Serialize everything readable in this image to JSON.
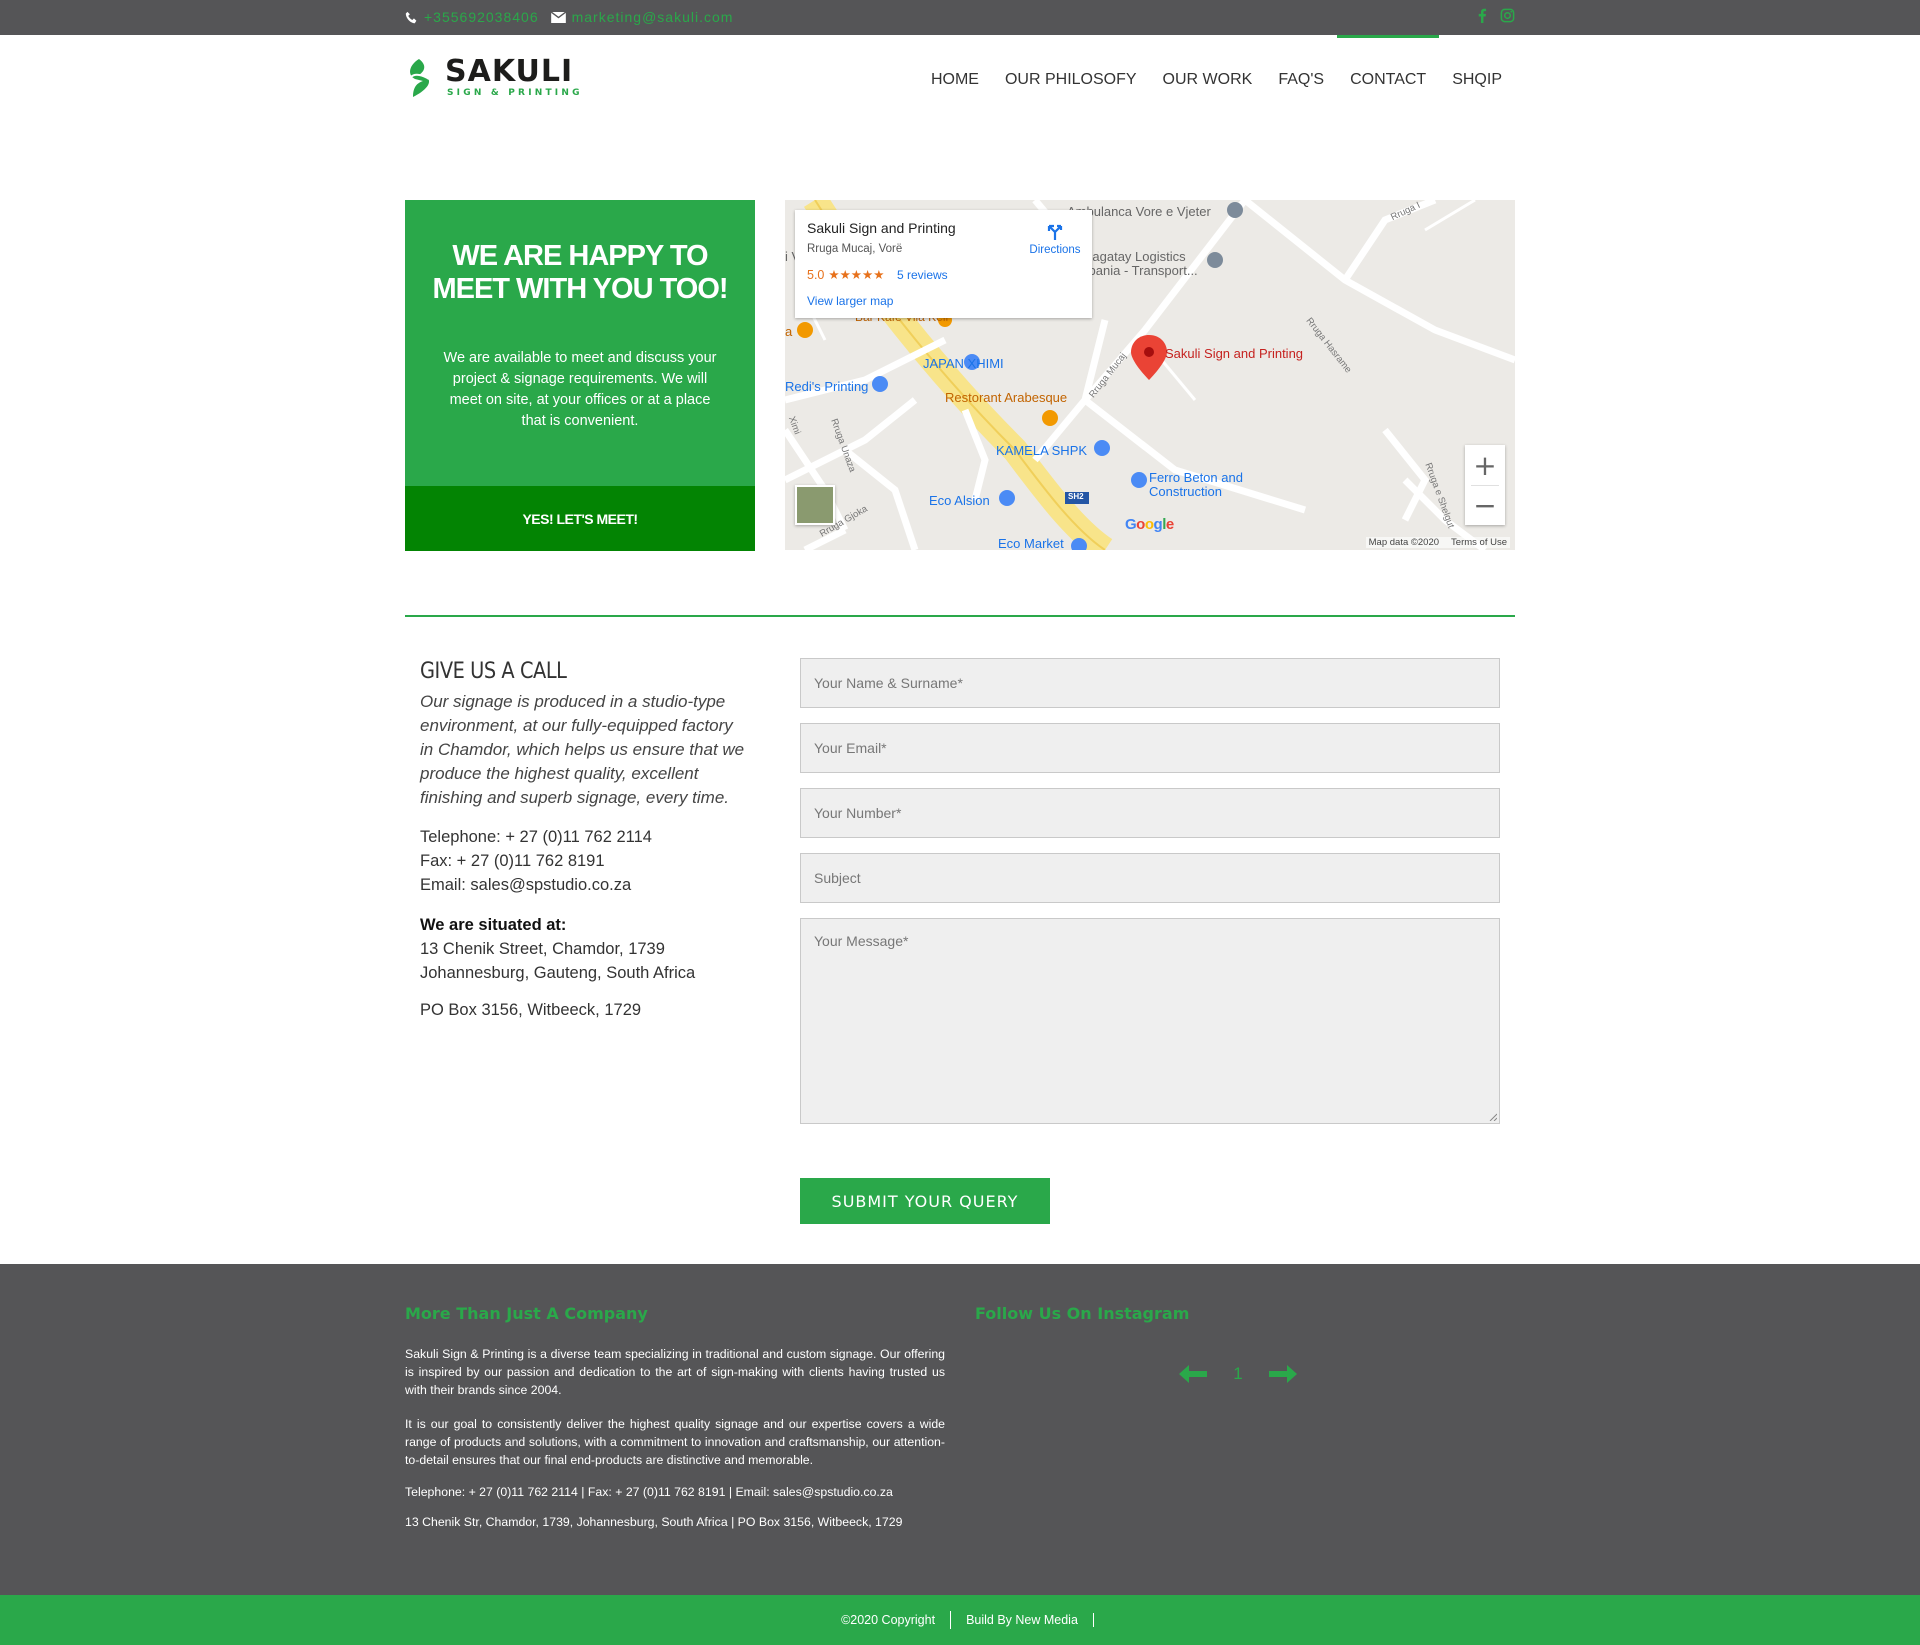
{
  "topbar": {
    "phone": "+355692038406",
    "email": "marketing@sakuli.com",
    "social": [
      "facebook-icon",
      "instagram-icon"
    ],
    "accent": "#2aa84a"
  },
  "logo": {
    "name": "SAKULI",
    "tagline": "SIGN & PRINTING"
  },
  "nav": [
    {
      "label": "HOME"
    },
    {
      "label": "OUR PHILOSOFY"
    },
    {
      "label": "OUR WORK"
    },
    {
      "label": "FAQ'S"
    },
    {
      "label": "CONTACT",
      "active": true
    },
    {
      "label": "SHQIP"
    }
  ],
  "meet": {
    "title": "WE ARE HAPPY TO MEET WITH YOU TOO!",
    "text": "We are available to meet and discuss your project & signage requirements. We will meet on site, at your offices or at a place that is convenient.",
    "button": "YES! LET'S MEET!"
  },
  "map": {
    "card": {
      "name": "Sakuli Sign and Printing",
      "address": "Rruga Mucaj, Vorë",
      "rating": "5.0",
      "stars": "★★★★★",
      "reviews": "5 reviews",
      "larger": "View larger map",
      "directions": "Directions"
    },
    "labels": {
      "ambulanca": "Ambulanca Vore e Vjeter",
      "logistics1": "Cagatay Logistics",
      "logistics2": "Albania - Transport...",
      "pin": "Sakuli Sign and Printing",
      "kafe": "Bar Kafe Vila Kell",
      "japan": "JAPAN XHIMI",
      "redis": "Redi's Printing",
      "arabesque": "Restorant Arabesque",
      "kamela": "KAMELA SHPK",
      "ferro1": "Ferro Beton and",
      "ferro2": "Construction",
      "alsion": "Eco Alsion",
      "market": "Eco Market",
      "sh2": "SH2",
      "rruga1": "Rruga Mucaj",
      "rruga2": "Rruga Hasrame",
      "rruga3": "Rruga Unaza",
      "rruga4": "Rruga Gjoka",
      "rruga5": "Rruga e Shelgut",
      "rruga6": "Rruga I",
      "v": "i V",
      "xhimi": "Ximi",
      "a": "a"
    },
    "google": "Google",
    "map_data": "Map data ©2020",
    "terms": "Terms of Use"
  },
  "contact": {
    "title": "GIVE US A CALL",
    "intro": "Our signage is produced in a studio-type environment, at our fully-equipped factory in Chamdor, which helps us ensure that we produce the highest quality, excellent finishing and superb signage, every time.",
    "telephone": "Telephone: + 27 (0)11 762 2114",
    "fax": "Fax: + 27 (0)11 762 8191",
    "email": "Email: sales@spstudio.co.za",
    "situated_label": "We are situated at:",
    "address1": "13 Chenik Street, Chamdor, 1739",
    "address2": "Johannesburg, Gauteng, South Africa",
    "po": "PO Box 3156, Witbeeck, 1729"
  },
  "form": {
    "name_ph": "Your Name & Surname*",
    "email_ph": "Your Email*",
    "number_ph": "Your Number*",
    "subject_ph": "Subject",
    "message_ph": "Your Message*",
    "submit": "SUBMIT YOUR QUERY"
  },
  "footer": {
    "col1_title": "More Than Just A Company",
    "p1": "Sakuli Sign & Printing is a diverse team specializing in traditional and custom signage. Our offering is inspired by our passion and dedication to the art of sign-making with clients having trusted us with their brands since 2004.",
    "p2": "It is our goal to consistently deliver the highest quality signage and our expertise covers a wide range of products and solutions, with a commitment to innovation and craftsmanship, our attention-to-detail ensures that our final end-products are distinctive and memorable.",
    "contact_line": "Telephone: + 27 (0)11 762 2114 | Fax: + 27 (0)11 762 8191 | Email: sales@spstudio.co.za",
    "address_line": "13 Chenik Str, Chamdor, 1739, Johannesburg, South Africa | PO Box 3156, Witbeeck, 1729",
    "col2_title": "Follow Us On Instagram",
    "page": "1"
  },
  "bottom": {
    "copyright": "©2020 Copyright",
    "built": "Build By New Media"
  }
}
